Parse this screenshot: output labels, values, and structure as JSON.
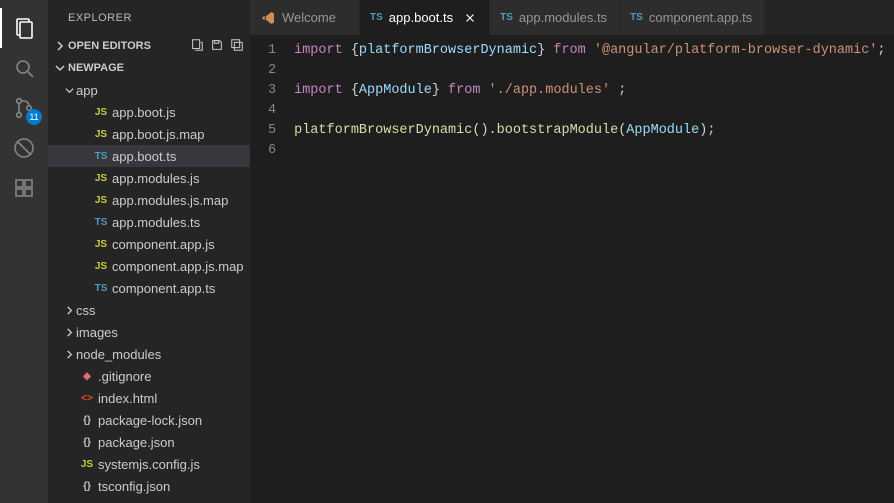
{
  "sidebar": {
    "title": "EXPLORER",
    "sections": {
      "openEditors": "OPEN EDITORS",
      "project": "NEWPAGE"
    }
  },
  "activity": {
    "scmBadge": "11"
  },
  "tree": {
    "folder_app": "app",
    "files": [
      "app.boot.js",
      "app.boot.js.map",
      "app.boot.ts",
      "app.modules.js",
      "app.modules.js.map",
      "app.modules.ts",
      "component.app.js",
      "component.app.js.map",
      "component.app.ts"
    ],
    "folder_css": "css",
    "folder_images": "images",
    "folder_node": "node_modules",
    "file_gitignore": ".gitignore",
    "file_index": "index.html",
    "file_pkglock": "package-lock.json",
    "file_pkg": "package.json",
    "file_sys": "systemjs.config.js",
    "file_tsconfig": "tsconfig.json"
  },
  "tabs": {
    "t0": "Welcome",
    "t1": "app.boot.ts",
    "t2": "app.modules.ts",
    "t3": "component.app.ts"
  },
  "code": {
    "l1_kw": "import",
    "l1_brace_o": " {",
    "l1_var": "platformBrowserDynamic",
    "l1_brace_c": "} ",
    "l1_from": "from",
    "l1_str": " '@angular/platform-browser-dynamic'",
    "l1_semi": ";",
    "l3_kw": "import",
    "l3_brace_o": " {",
    "l3_var": "AppModule",
    "l3_brace_c": "} ",
    "l3_from": "from",
    "l3_str": " './app.modules' ",
    "l3_semi": ";",
    "l5_fn1": "platformBrowserDynamic",
    "l5_p1": "().",
    "l5_fn2": "bootstrapModule",
    "l5_p2": "(",
    "l5_arg": "AppModule",
    "l5_p3": ");",
    "lineNumbers": [
      "1",
      "2",
      "3",
      "4",
      "5",
      "6"
    ]
  }
}
